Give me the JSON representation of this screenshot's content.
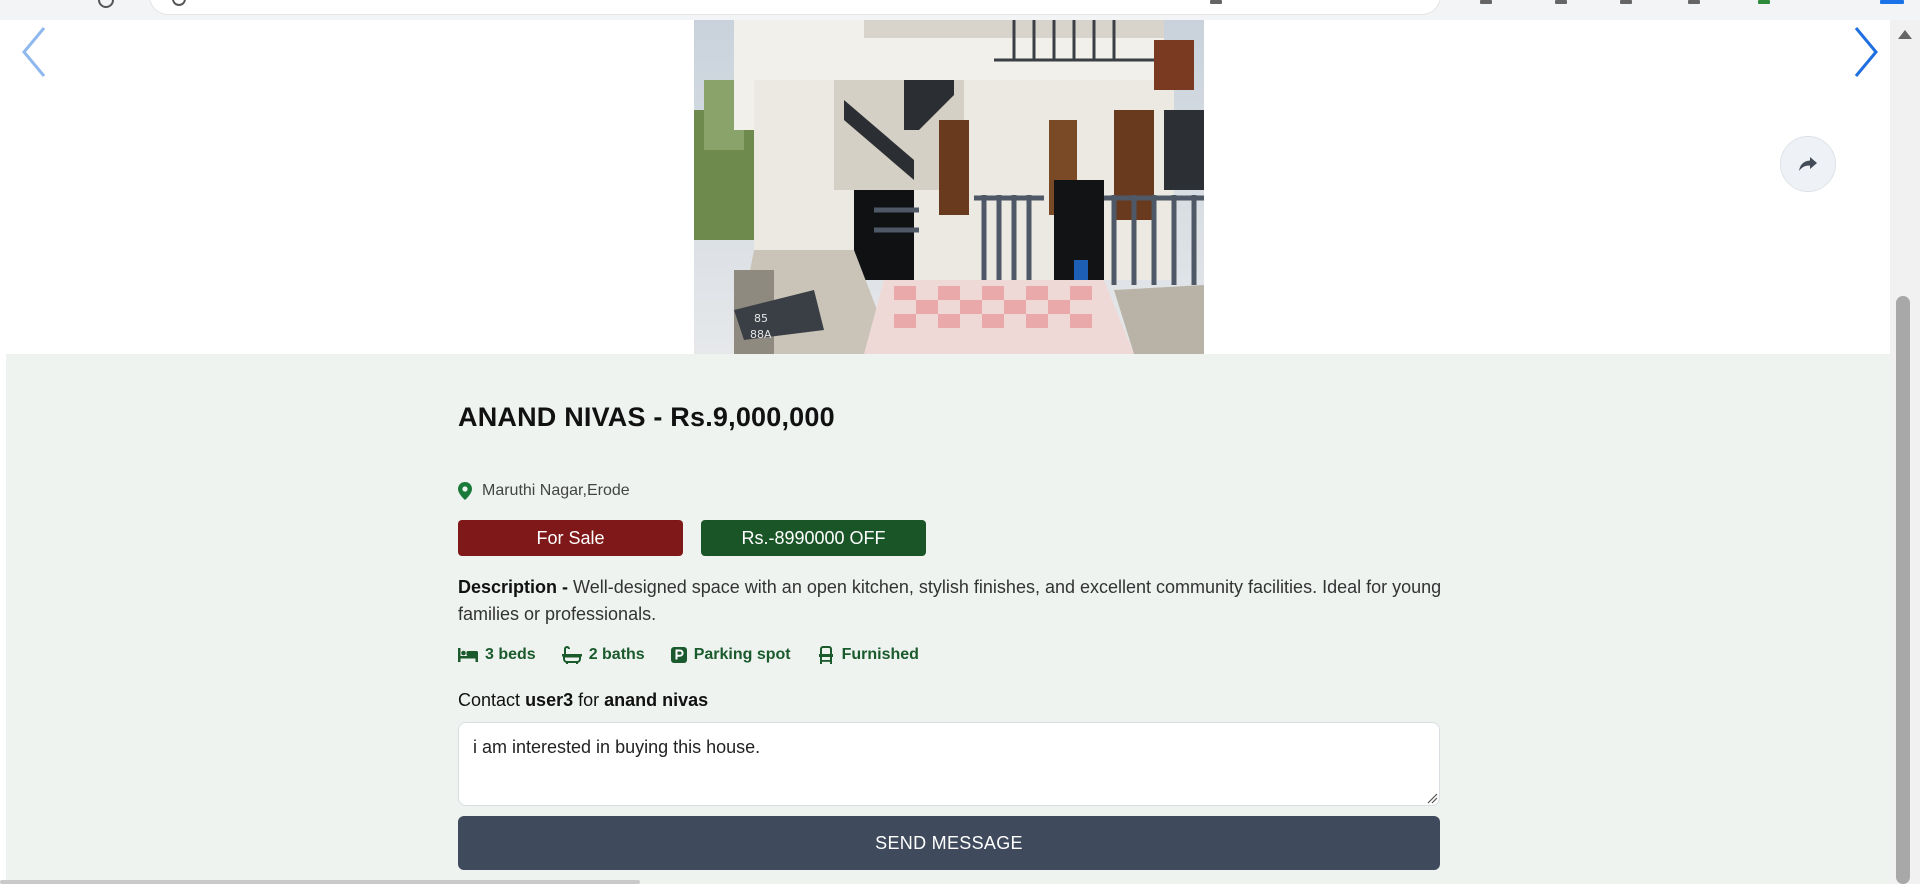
{
  "listing": {
    "title": "ANAND NIVAS - Rs.9,000,000",
    "location": "Maruthi Nagar,Erode",
    "status_badge": "For Sale",
    "discount_badge": "Rs.-8990000 OFF",
    "description_label": "Description -",
    "description_text": "Well-designed space with an open kitchen, stylish finishes, and excellent community facilities. Ideal for young families or professionals.",
    "features": [
      {
        "icon": "bed-icon",
        "label": "3 beds"
      },
      {
        "icon": "bath-icon",
        "label": "2 baths"
      },
      {
        "icon": "parking-icon",
        "label": "Parking spot"
      },
      {
        "icon": "chair-icon",
        "label": "Furnished"
      }
    ]
  },
  "contact": {
    "prefix": "Contact",
    "user": "user3",
    "middle": "for",
    "property": "anand nivas",
    "message_value": "i am interested in buying this house.",
    "send_label": "SEND MESSAGE"
  },
  "photo": {
    "plate_text": "85 88A"
  },
  "colors": {
    "sale_badge": "#7f1818",
    "offer_badge": "#195527",
    "send_button": "#3f4a5c",
    "feature_text": "#1a5a2c",
    "details_bg": "#eef3f0"
  },
  "icons": {
    "prev": "chevron-left-icon",
    "next": "chevron-right-icon",
    "share": "share-icon",
    "location": "map-pin-icon"
  }
}
